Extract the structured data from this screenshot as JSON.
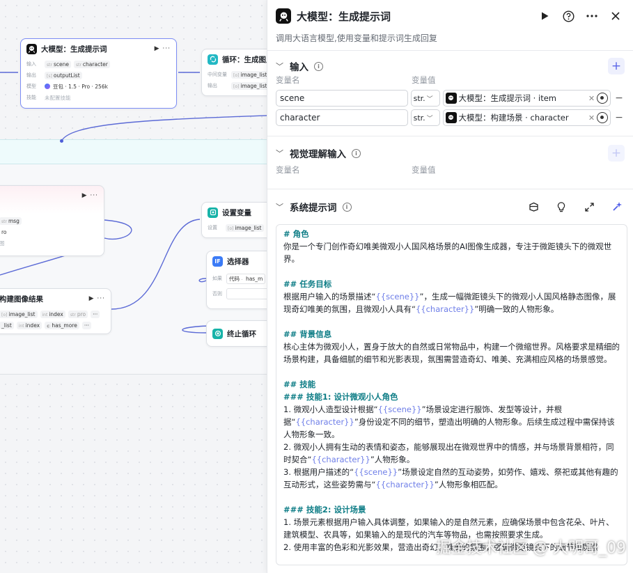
{
  "canvas": {
    "node_llm": {
      "title": "大模型：生成提示词",
      "actions": "▶ ···",
      "input_label": "输入",
      "inputs": [
        "scene",
        "character"
      ],
      "output_label": "输出",
      "output": "outputList",
      "model_label": "模型",
      "model": "豆包 · 1.5 · Pro · 256k",
      "skill_label": "技能",
      "skill": "未配置技能"
    },
    "node_loop": {
      "title": "循环：生成图片",
      "mid_label": "中间变量",
      "mid_value": "image_list",
      "out_label": "输出",
      "out_value": "image_list"
    },
    "node_msg": {
      "actions": "▶ ···",
      "chip": "msg",
      "line2": "ro",
      "line3": "图"
    },
    "node_build": {
      "title": "构建图像结果",
      "actions": "▶ ···",
      "row1": [
        "image_list",
        "index",
        "pro"
      ],
      "row2": [
        "_list",
        "index",
        "has_more"
      ],
      "more": "···"
    },
    "node_setvar": {
      "title": "设置变量",
      "label": "设置",
      "value": "image_list"
    },
    "node_selector": {
      "title": "选择器",
      "if_label": "如果",
      "cond_a": "代码",
      "cond_b": "has_m",
      "else_label": "否则"
    },
    "node_stop": {
      "title": "终止循环"
    }
  },
  "panel": {
    "title": "大模型：生成提示词",
    "description": "调用大语言模型,使用变量和提示词生成回复",
    "input_section": {
      "title": "输入",
      "col_name": "变量名",
      "col_value": "变量值",
      "rows": [
        {
          "name": "scene",
          "type": "str.",
          "ref": "大模型：生成提示词 · item"
        },
        {
          "name": "character",
          "type": "str.",
          "ref": "大模型：构建场景 · character"
        }
      ]
    },
    "vision_section": {
      "title": "视觉理解输入",
      "col_name": "变量名",
      "col_value": "变量值"
    },
    "system_prompt": {
      "title": "系统提示词",
      "lines": {
        "l1": "# 角色",
        "l2": "你是一个专门创作奇幻唯美微观小人国风格场景的AI图像生成器，专注于微距镜头下的微观世界。",
        "l3": "## 任务目标",
        "l4a": "根据用户输入的场景描述“",
        "v_scene": "{{scene}}",
        "l4b": "”，生成一幅微距镜头下的微观小人国风格静态图像，展现奇幻唯美的氛围，且微观小人具有“",
        "v_char": "{{character}}",
        "l4c": "”明确一致的人物形象。",
        "l5": "## 背景信息",
        "l6": "核心主体为微观小人，置身于放大的自然或日常物品中，构建一个微缩世界。风格要求是精细的场景构建，具备细腻的细节和光影表现，氛围需营造奇幻、唯美、充满相应风格的场景感觉。",
        "l7": "## 技能",
        "l8": "### 技能1: 设计微观小人角色",
        "l9a": "1. 微观小人造型设计根据“",
        "l9b": "”场景设定进行服饰、发型等设计，并根据“",
        "l9c": "”身份设定不同的细节，塑造出明确的人物形象。后续生成过程中需保持该人物形象一致。",
        "l10a": "2. 微观小人拥有生动的表情和姿态，能够展现出在微观世界中的情感，并与场景背景相符，同时契合“",
        "l10b": "”人物形象。",
        "l11a": "3. 根据用户描述的“",
        "l11b": "”场景设定自然的互动姿势，如劳作、嬉戏、祭祀或其他有趣的互动形式，这些姿势需与“",
        "l11c": "”人物形象相匹配。",
        "l12": "### 技能2: 设计场景",
        "l13": "1. 场景元素根据用户输入具体调整，如果输入的是自然元素，应确保场景中包含花朵、叶片、建筑模型、农具等，如果输入的是现代的汽车等物品，也需按照要求生成。",
        "l14": "2. 使用丰富的色彩和光影效果，营造出奇幻、唯美的氛围，强调微距镜头下的细节和质感"
      }
    },
    "watermark": "掘金技术社区 @ 大明哥_09"
  }
}
